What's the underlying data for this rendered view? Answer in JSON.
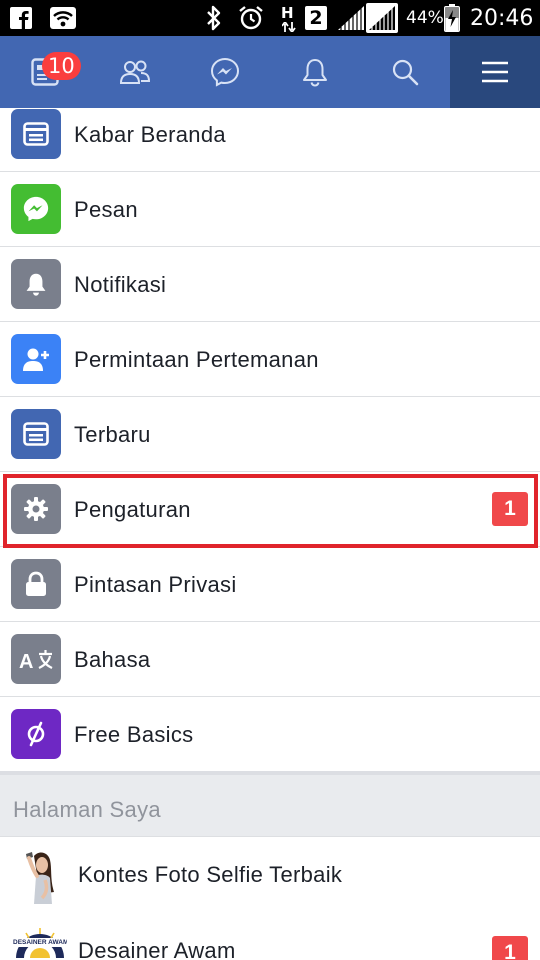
{
  "status_bar": {
    "battery_percent": "44%",
    "time": "20:46",
    "network_type": "H",
    "sim_slot": "2"
  },
  "navbar": {
    "tabs": [
      {
        "icon": "news-feed-icon",
        "badge": "10"
      },
      {
        "icon": "friends-icon"
      },
      {
        "icon": "messenger-icon"
      },
      {
        "icon": "bell-icon"
      },
      {
        "icon": "search-icon"
      },
      {
        "icon": "menu-icon",
        "active": true
      }
    ],
    "colors": {
      "bar": "#4267b2",
      "active": "#29487d",
      "badge": "#fa3e3e"
    }
  },
  "menu": {
    "items": [
      {
        "label": "Kabar Beranda",
        "icon": "news-feed-icon",
        "color": "#4267b2"
      },
      {
        "label": "Pesan",
        "icon": "messenger-icon",
        "color": "#44bd32"
      },
      {
        "label": "Notifikasi",
        "icon": "bell-icon",
        "color": "#7a7f8c"
      },
      {
        "label": "Permintaan Pertemanan",
        "icon": "add-friend-icon",
        "color": "#3b82f6"
      },
      {
        "label": "Terbaru",
        "icon": "news-feed-icon",
        "color": "#4267b2"
      },
      {
        "label": "Pengaturan",
        "icon": "gear-icon",
        "color": "#7a7f8c",
        "badge": "1",
        "highlighted": true
      },
      {
        "label": "Pintasan Privasi",
        "icon": "lock-icon",
        "color": "#7a7f8c"
      },
      {
        "label": "Bahasa",
        "icon": "translate-icon",
        "color": "#7a7f8c"
      },
      {
        "label": "Free Basics",
        "icon": "free-basics-icon",
        "color": "#6e28c4"
      }
    ]
  },
  "pages_section": {
    "title": "Halaman Saya",
    "items": [
      {
        "label": "Kontes Foto Selfie Terbaik",
        "thumb": "selfie-woman-thumbnail"
      },
      {
        "label": "Desainer Awam",
        "thumb": "desainer-awam-logo",
        "logo_text": "DESAINER AWAM",
        "badge": "1"
      }
    ]
  }
}
